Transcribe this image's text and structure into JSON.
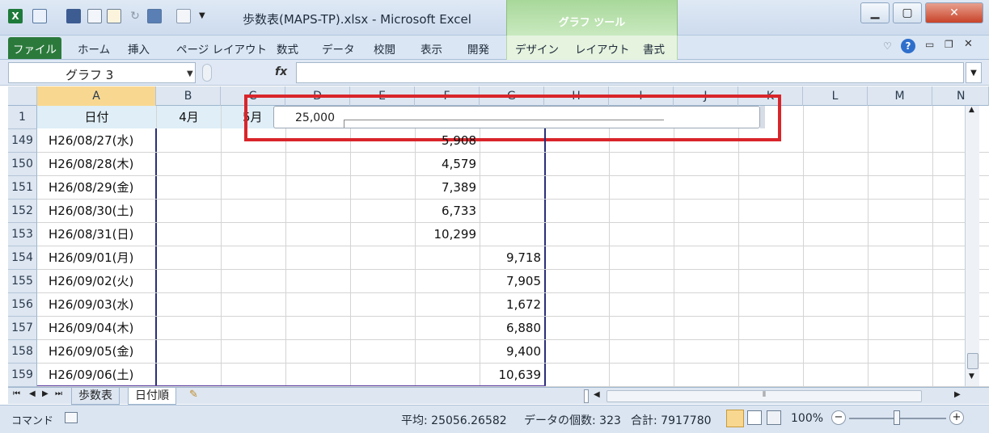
{
  "window": {
    "title": "歩数表(MAPS-TP).xlsx  -  Microsoft Excel",
    "context_group": "グラフ ツール"
  },
  "ribbon": {
    "file_tab": "ファイル",
    "tabs": [
      "ホーム",
      "挿入",
      "ページ レイアウト",
      "数式",
      "データ",
      "校閲",
      "表示",
      "開発"
    ],
    "chart_tabs": [
      "デザイン",
      "レイアウト",
      "書式"
    ]
  },
  "formula_bar": {
    "name_box": "グラフ 3",
    "fx": "fx",
    "value": ""
  },
  "columns": [
    "A",
    "B",
    "C",
    "D",
    "E",
    "F",
    "G",
    "H",
    "I",
    "J",
    "K",
    "L",
    "M",
    "N"
  ],
  "header_row": {
    "num": "1",
    "a": "日付",
    "b": "4月",
    "c": "5月"
  },
  "chart_overlay": {
    "top_tick_label": "25,000"
  },
  "rows": [
    {
      "num": "149",
      "date": "H26/08/27(水)",
      "f": "5,908",
      "g": ""
    },
    {
      "num": "150",
      "date": "H26/08/28(木)",
      "f": "4,579",
      "g": ""
    },
    {
      "num": "151",
      "date": "H26/08/29(金)",
      "f": "7,389",
      "g": ""
    },
    {
      "num": "152",
      "date": "H26/08/30(土)",
      "f": "6,733",
      "g": ""
    },
    {
      "num": "153",
      "date": "H26/08/31(日)",
      "f": "10,299",
      "g": ""
    },
    {
      "num": "154",
      "date": "H26/09/01(月)",
      "f": "",
      "g": "9,718"
    },
    {
      "num": "155",
      "date": "H26/09/02(火)",
      "f": "",
      "g": "7,905"
    },
    {
      "num": "156",
      "date": "H26/09/03(水)",
      "f": "",
      "g": "1,672"
    },
    {
      "num": "157",
      "date": "H26/09/04(木)",
      "f": "",
      "g": "6,880"
    },
    {
      "num": "158",
      "date": "H26/09/05(金)",
      "f": "",
      "g": "9,400"
    },
    {
      "num": "159",
      "date": "H26/09/06(土)",
      "f": "",
      "g": "10,639"
    }
  ],
  "sheets": [
    "歩数表",
    "日付順"
  ],
  "status": {
    "mode": "コマンド",
    "average": "平均: 25056.26582",
    "count": "データの個数: 323",
    "sum": "合計: 7917780",
    "zoom": "100%"
  },
  "colors": {
    "file_tab": "#2b7a3c",
    "context_green": "#a8d89a",
    "highlight_box": "#d9252a",
    "header_cell": "#dfeef7"
  }
}
